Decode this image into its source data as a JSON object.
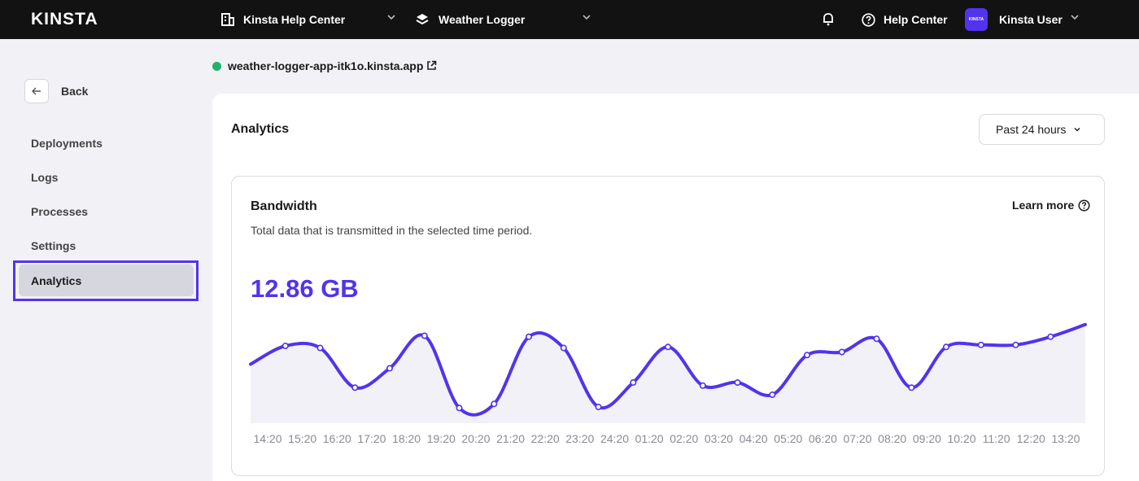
{
  "topbar": {
    "logo": "KINSTA",
    "company_switcher": "Kinsta Help Center",
    "app_switcher": "Weather Logger",
    "help_label": "Help Center",
    "avatar_text": "KINSTA",
    "user_name": "Kinsta User"
  },
  "sidebar": {
    "back_label": "Back",
    "items": [
      {
        "label": "Deployments"
      },
      {
        "label": "Logs"
      },
      {
        "label": "Processes"
      },
      {
        "label": "Settings"
      },
      {
        "label": "Analytics"
      }
    ],
    "active_item": "Analytics"
  },
  "app": {
    "url": "weather-logger-app-itk1o.kinsta.app",
    "status": "running"
  },
  "main": {
    "title": "Analytics",
    "time_range": "Past 24 hours"
  },
  "bandwidth": {
    "title": "Bandwidth",
    "description": "Total data that is transmitted in the selected time period.",
    "learn_more": "Learn more",
    "total": "12.86 GB"
  },
  "colors": {
    "accent": "#5333ed",
    "topbar": "#121212",
    "status_ok": "#1fb36b",
    "area_fill": "#f1f1f7"
  },
  "chart_data": {
    "type": "area",
    "x": [
      "14:20",
      "15:20",
      "16:20",
      "17:20",
      "18:20",
      "19:20",
      "20:20",
      "21:20",
      "22:20",
      "23:20",
      "24:20",
      "01:20",
      "02:20",
      "03:20",
      "04:20",
      "05:20",
      "06:20",
      "07:20",
      "08:20",
      "09:20",
      "10:20",
      "11:20",
      "12:20",
      "13:20"
    ],
    "values": [
      0.58,
      0.76,
      0.74,
      0.35,
      0.54,
      0.86,
      0.15,
      0.19,
      0.85,
      0.74,
      0.16,
      0.4,
      0.75,
      0.37,
      0.4,
      0.28,
      0.67,
      0.7,
      0.83,
      0.35,
      0.75,
      0.77,
      0.77,
      0.85,
      0.97
    ],
    "grid": false,
    "legend": "none"
  }
}
